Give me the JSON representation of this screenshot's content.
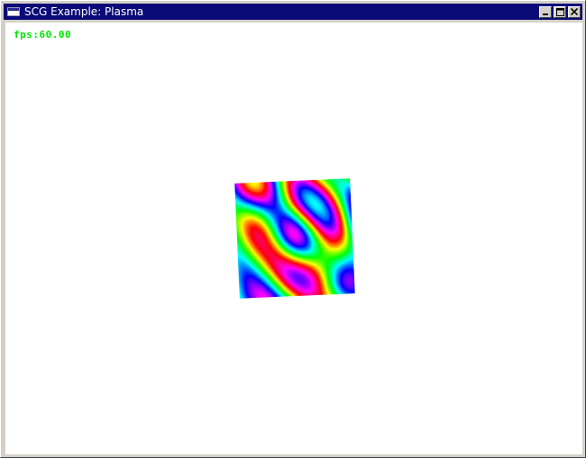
{
  "window": {
    "title": "SCG Example: Plasma",
    "icon": "window-icon",
    "controls": {
      "minimize_icon": "minimize-icon",
      "maximize_icon": "maximize-icon",
      "close_icon": "close-icon"
    }
  },
  "overlay": {
    "fps_text": "fps:60.00"
  },
  "colors": {
    "titlebar": "#0a0a78",
    "fps_text": "#00e600",
    "client_background": "#ffffff"
  }
}
